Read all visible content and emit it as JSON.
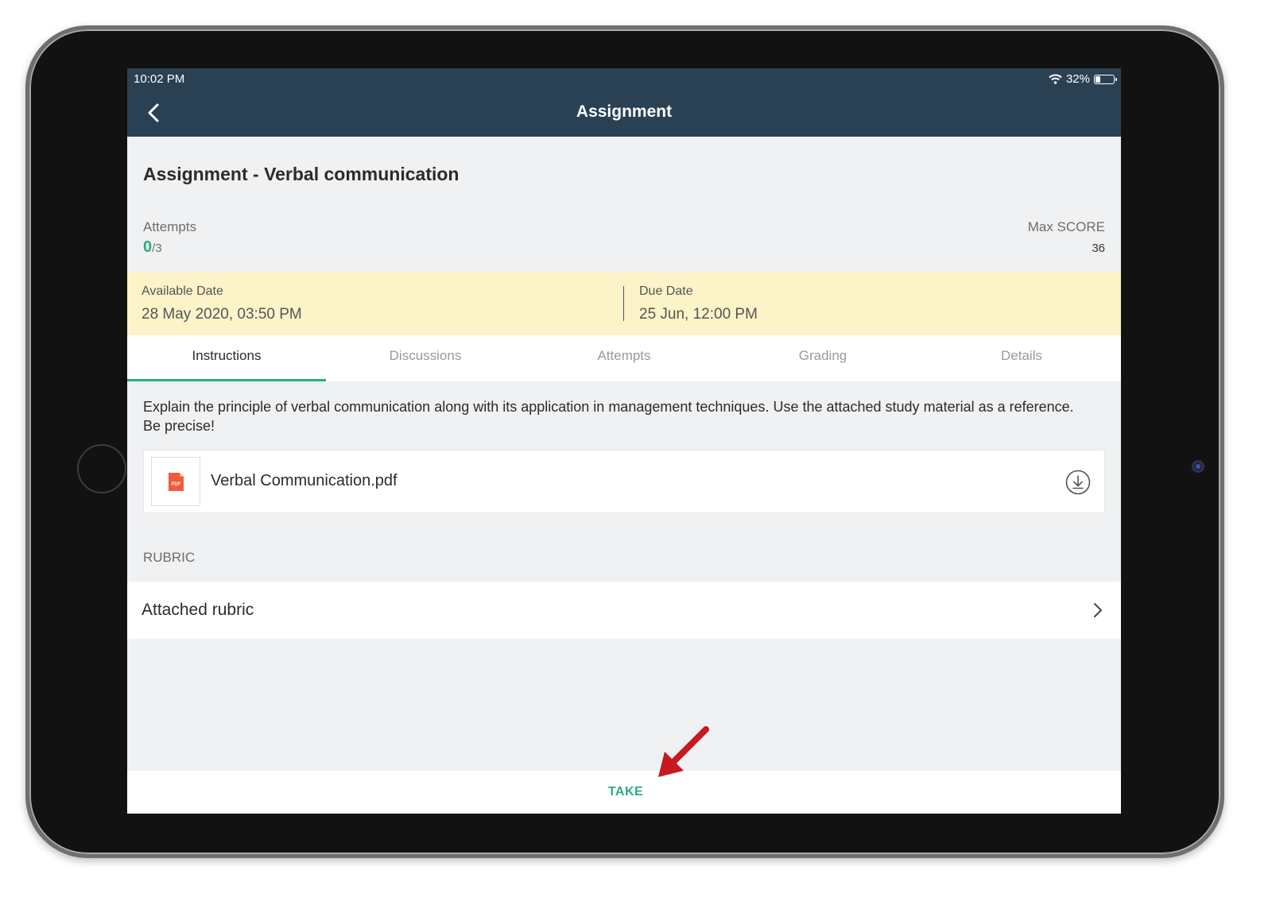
{
  "status_bar": {
    "time": "10:02 PM",
    "battery": "32%",
    "battery_level": 0.32
  },
  "header": {
    "title": "Assignment"
  },
  "assignment": {
    "title": "Assignment - Verbal communication"
  },
  "attempts": {
    "label": "Attempts",
    "used": "0",
    "total": "/3"
  },
  "score": {
    "label": "Max SCORE",
    "value": "36"
  },
  "dates": {
    "available_label": "Available Date",
    "available_value": "28 May 2020, 03:50 PM",
    "due_label": "Due Date",
    "due_value": "25 Jun, 12:00 PM"
  },
  "tabs": [
    {
      "label": "Instructions",
      "active": true
    },
    {
      "label": "Discussions",
      "active": false
    },
    {
      "label": "Attempts",
      "active": false
    },
    {
      "label": "Grading",
      "active": false
    },
    {
      "label": "Details",
      "active": false
    }
  ],
  "instructions": {
    "text": "Explain the principle of verbal communication along with its application in management techniques. Use the attached study material as a reference. Be precise!"
  },
  "attachment": {
    "file_name": "Verbal Communication.pdf",
    "icon_text": "PDF",
    "icon": "pdf-file-icon"
  },
  "rubric": {
    "heading": "RUBRIC",
    "item_label": "Attached rubric"
  },
  "footer": {
    "take_label": "TAKE"
  },
  "colors": {
    "header": "#2a4154",
    "accent": "#27b07b",
    "date_band": "#fcf3c8",
    "pdf": "#f15a3a",
    "arrow": "#c8191e"
  }
}
